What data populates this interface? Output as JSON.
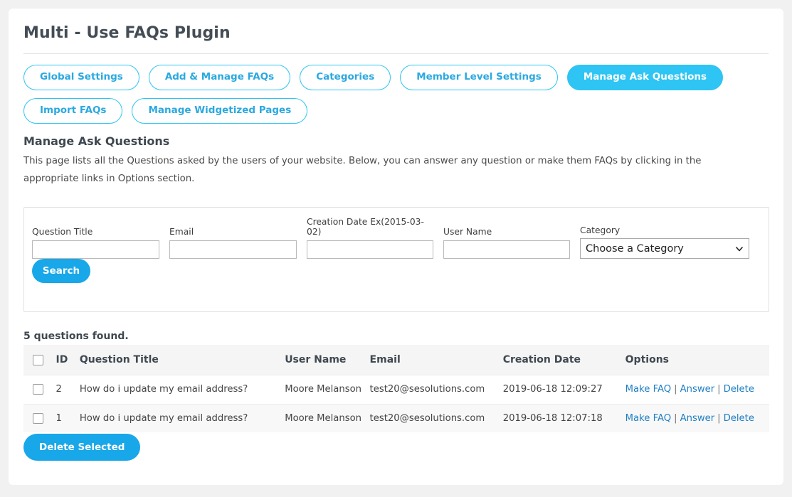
{
  "page": {
    "title": "Multi - Use FAQs Plugin",
    "background_color": "#f1f1f1",
    "accent_color": "#2ec4f3",
    "button_color": "#18a7e8",
    "link_color": "#1f7fc4"
  },
  "tabs": [
    {
      "label": "Global Settings",
      "active": false
    },
    {
      "label": "Add & Manage FAQs",
      "active": false
    },
    {
      "label": "Categories",
      "active": false
    },
    {
      "label": "Member Level Settings",
      "active": false
    },
    {
      "label": "Manage Ask Questions",
      "active": true
    },
    {
      "label": "Import FAQs",
      "active": false
    },
    {
      "label": "Manage Widgetized Pages",
      "active": false
    }
  ],
  "section": {
    "heading": "Manage Ask Questions",
    "description": "This page lists all the Questions asked by the users of your website. Below, you can answer any question or make them FAQs by clicking in the appropriate links in Options section."
  },
  "search_form": {
    "fields": {
      "question_title": {
        "label": "Question Title",
        "value": "",
        "placeholder": ""
      },
      "email": {
        "label": "Email",
        "value": "",
        "placeholder": ""
      },
      "creation_date": {
        "label": "Creation Date Ex(2015-03-02)",
        "value": "",
        "placeholder": ""
      },
      "user_name": {
        "label": "User Name",
        "value": "",
        "placeholder": ""
      },
      "category": {
        "label": "Category",
        "selected": "Choose a Category",
        "options": [
          "Choose a Category"
        ]
      }
    },
    "search_button": "Search"
  },
  "results": {
    "count_text": "5 questions found.",
    "columns": [
      "",
      "ID",
      "Question Title",
      "User Name",
      "Email",
      "Creation Date",
      "Options"
    ],
    "rows": [
      {
        "checked": false,
        "id": "2",
        "question_title": "How do i update my email address?",
        "user_name": "Moore Melanson",
        "email": "test20@sesolutions.com",
        "creation_date": "2019-06-18 12:09:27",
        "options": [
          "Make FAQ",
          "Answer",
          "Delete"
        ]
      },
      {
        "checked": false,
        "id": "1",
        "question_title": "How do i update my email address?",
        "user_name": "Moore Melanson",
        "email": "test20@sesolutions.com",
        "creation_date": "2019-06-18 12:07:18",
        "options": [
          "Make FAQ",
          "Answer",
          "Delete"
        ]
      }
    ],
    "options_separator": "|"
  },
  "footer": {
    "delete_selected_label": "Delete Selected"
  }
}
